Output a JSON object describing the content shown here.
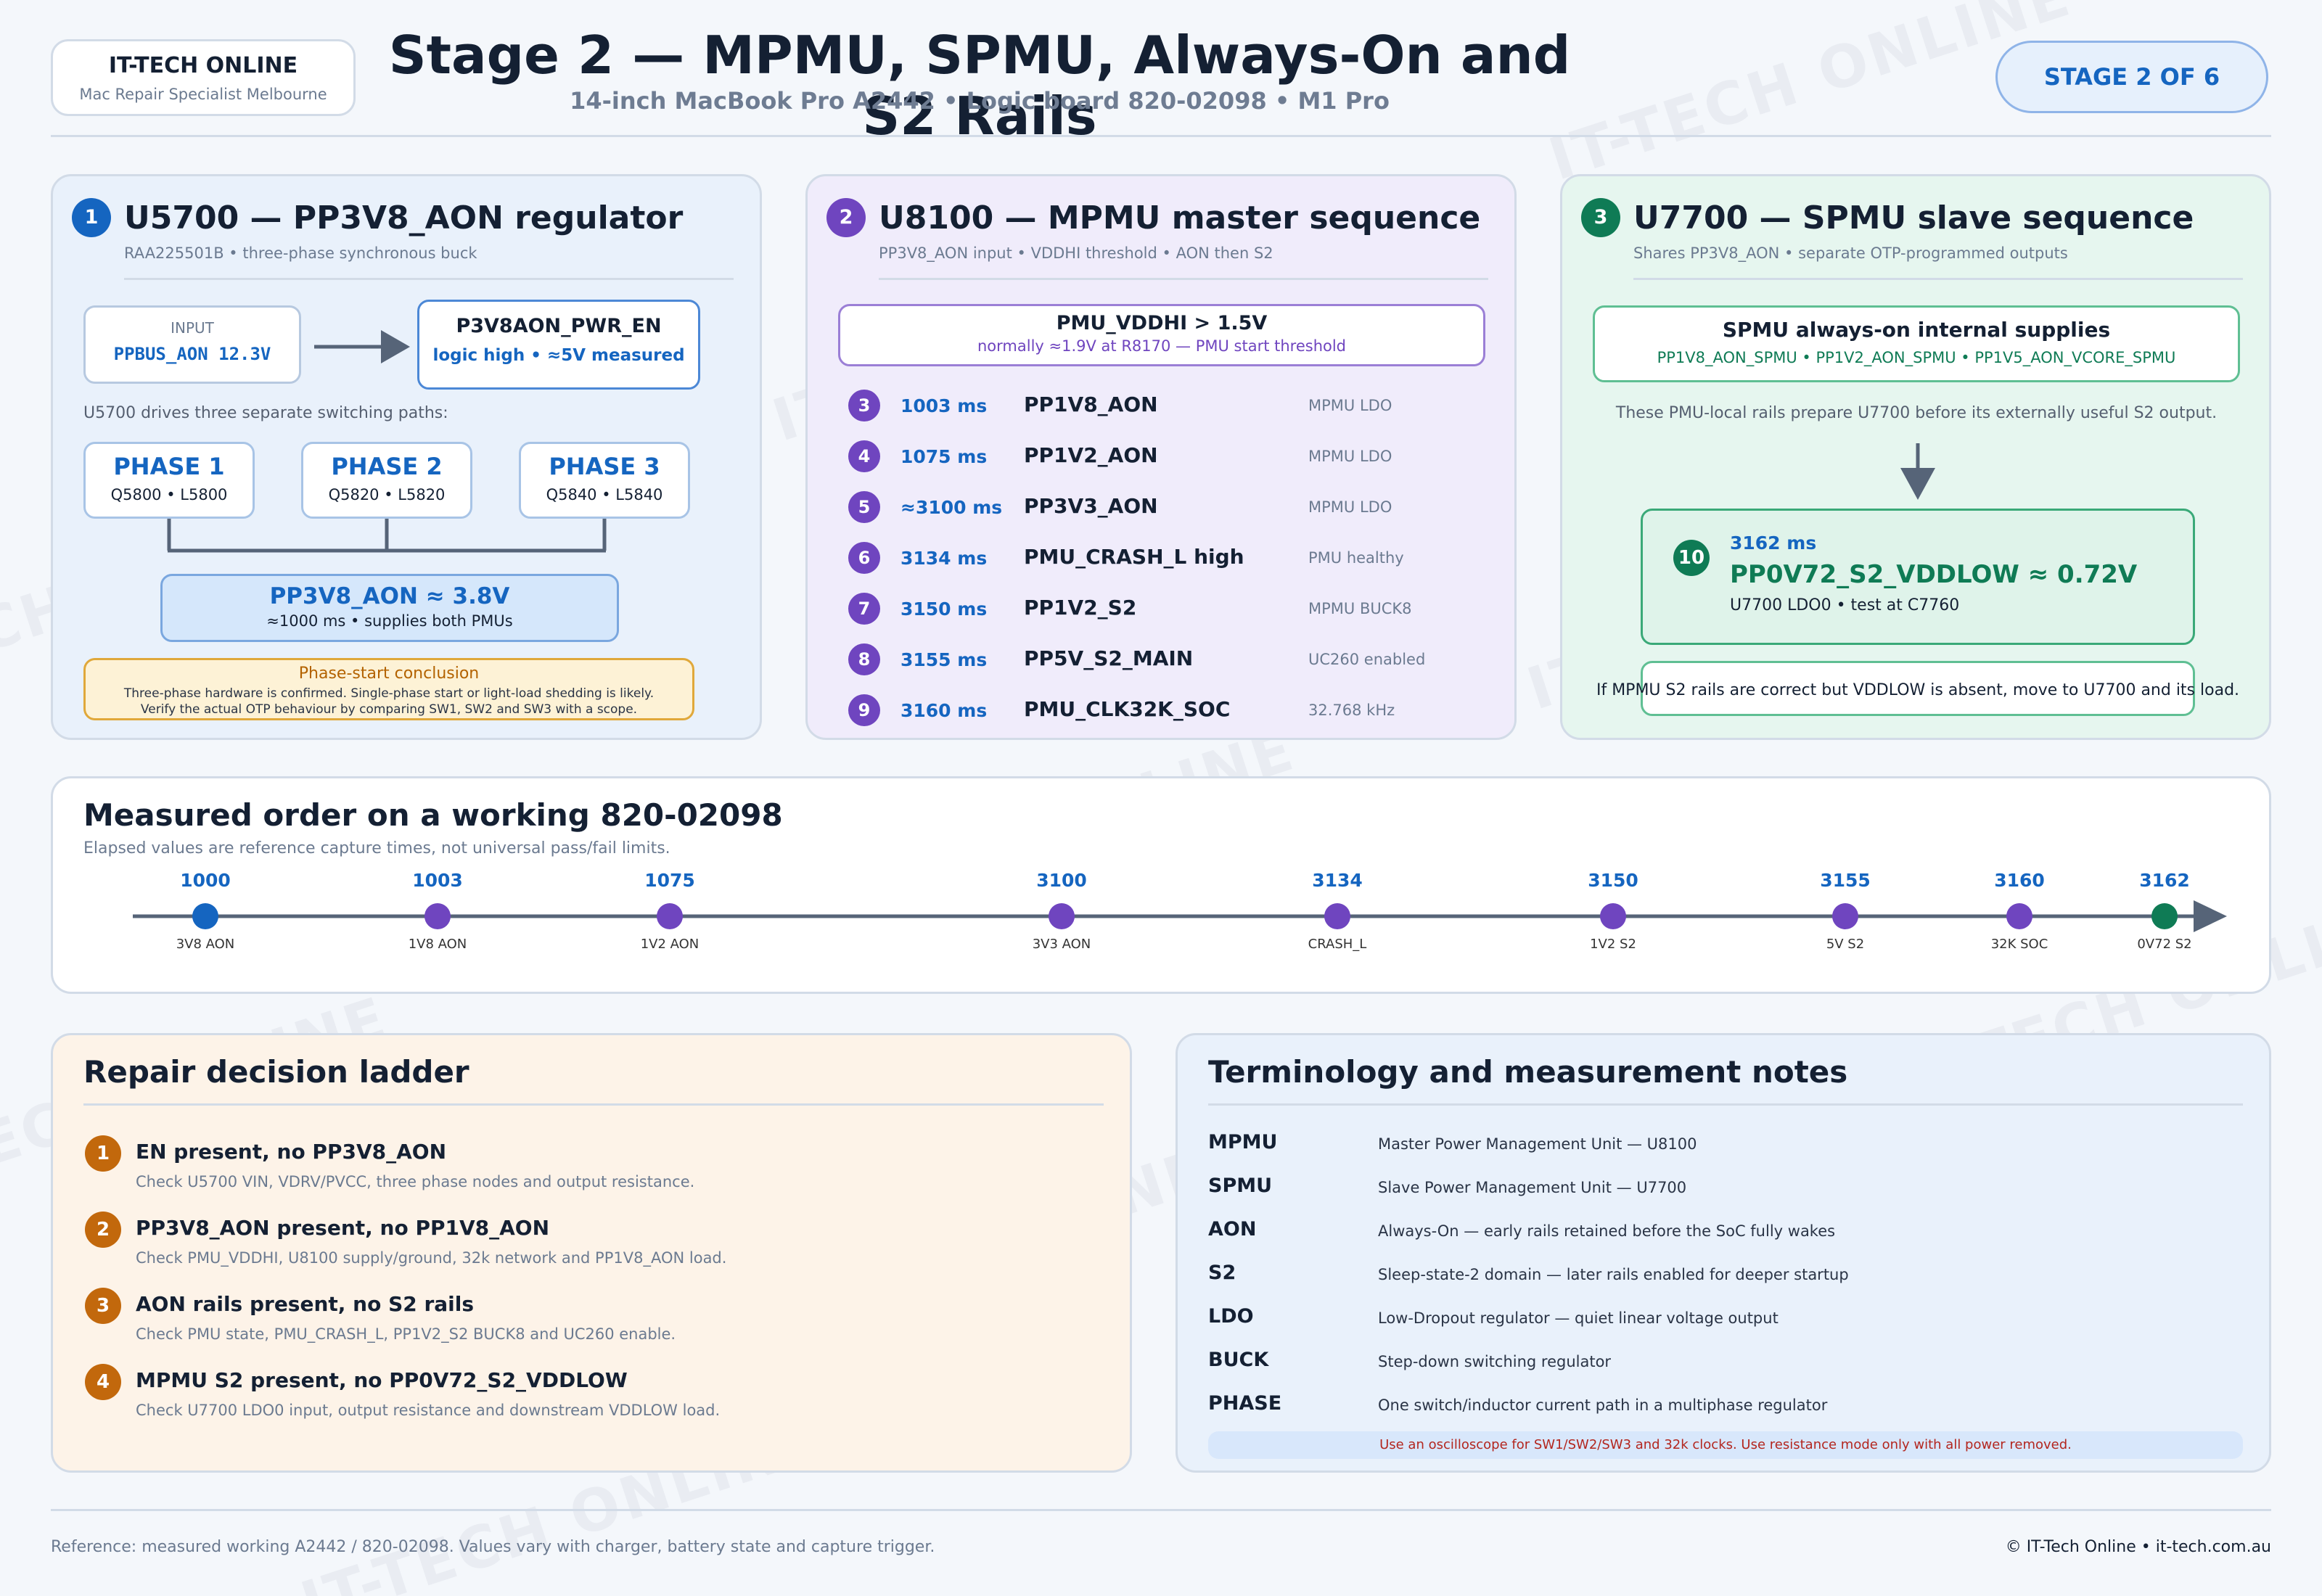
{
  "brand": {
    "name": "IT-TECH ONLINE",
    "tagline": "Mac Repair Specialist Melbourne"
  },
  "header": {
    "title": "Stage 2 — MPMU, SPMU, Always-On and S2 Rails",
    "subtitle": "14-inch MacBook Pro A2442 • Logic board 820-02098 • M1 Pro",
    "stage_badge": "STAGE 2 OF 6"
  },
  "watermark": "IT-TECH ONLINE",
  "panel1": {
    "num": "1",
    "title": "U5700 — PP3V8_AON regulator",
    "subtitle": "RAA225501B • three-phase synchronous buck",
    "input_label": "INPUT",
    "input_value": "PPBUS_AON 12.3V",
    "enable_name": "P3V8AON_PWR_EN",
    "enable_value": "logic high • ≈5V measured",
    "drives_text": "U5700 drives three separate switching paths:",
    "phases": [
      {
        "name": "PHASE 1",
        "parts": "Q5800 • L5800"
      },
      {
        "name": "PHASE 2",
        "parts": "Q5820 • L5820"
      },
      {
        "name": "PHASE 3",
        "parts": "Q5840 • L5840"
      }
    ],
    "output_name": "PP3V8_AON ≈ 3.8V",
    "output_note": "≈1000 ms • supplies both PMUs",
    "conclusion_title": "Phase-start conclusion",
    "conclusion_line1": "Three-phase hardware is confirmed. Single-phase start or light-load shedding is likely.",
    "conclusion_line2": "Verify the actual OTP behaviour by comparing SW1, SW2 and SW3 with a scope."
  },
  "panel2": {
    "num": "2",
    "title": "U8100 — MPMU master sequence",
    "subtitle": "PP3V8_AON input • VDDHI threshold • AON then S2",
    "threshold_title": "PMU_VDDHI > 1.5V",
    "threshold_note": "normally ≈1.9V at R8170 — PMU start threshold",
    "steps": [
      {
        "num": "3",
        "time": "1003 ms",
        "name": "PP1V8_AON",
        "desc": "MPMU LDO"
      },
      {
        "num": "4",
        "time": "1075 ms",
        "name": "PP1V2_AON",
        "desc": "MPMU LDO"
      },
      {
        "num": "5",
        "time": "≈3100 ms",
        "name": "PP3V3_AON",
        "desc": "MPMU LDO"
      },
      {
        "num": "6",
        "time": "3134 ms",
        "name": "PMU_CRASH_L high",
        "desc": "PMU healthy"
      },
      {
        "num": "7",
        "time": "3150 ms",
        "name": "PP1V2_S2",
        "desc": "MPMU BUCK8"
      },
      {
        "num": "8",
        "time": "3155 ms",
        "name": "PP5V_S2_MAIN",
        "desc": "UC260 enabled"
      },
      {
        "num": "9",
        "time": "3160 ms",
        "name": "PMU_CLK32K_SOC",
        "desc": "32.768 kHz"
      }
    ]
  },
  "panel3": {
    "num": "3",
    "title": "U7700 — SPMU slave sequence",
    "subtitle": "Shares PP3V8_AON • separate OTP-programmed outputs",
    "internal_title": "SPMU always-on internal supplies",
    "internal_rails": "PP1V8_AON_SPMU • PP1V2_AON_SPMU • PP1V5_AON_VCORE_SPMU",
    "internal_note": "These PMU-local rails prepare U7700 before its externally useful S2 output.",
    "out_num": "10",
    "out_time": "3162 ms",
    "out_name": "PP0V72_S2_VDDLOW ≈ 0.72V",
    "out_note": "U7700 LDO0 • test at C7760",
    "footer_note": "If MPMU S2 rails are correct but VDDLOW is absent, move to U7700 and its load."
  },
  "timeline": {
    "title": "Measured order on a working 820-02098",
    "subtitle": "Elapsed values are reference capture times, not universal pass/fail limits.",
    "points": [
      {
        "t": 1000,
        "label": "1000",
        "name": "3V8 AON",
        "color": "#1565c0"
      },
      {
        "t": 1003,
        "label": "1003",
        "name": "1V8 AON",
        "color": "#6f45bf"
      },
      {
        "t": 1075,
        "label": "1075",
        "name": "1V2 AON",
        "color": "#6f45bf"
      },
      {
        "t": 3100,
        "label": "3100",
        "name": "3V3 AON",
        "color": "#6f45bf"
      },
      {
        "t": 3134,
        "label": "3134",
        "name": "CRASH_L",
        "color": "#6f45bf"
      },
      {
        "t": 3150,
        "label": "3150",
        "name": "1V2 S2",
        "color": "#6f45bf"
      },
      {
        "t": 3155,
        "label": "3155",
        "name": "5V S2",
        "color": "#6f45bf"
      },
      {
        "t": 3160,
        "label": "3160",
        "name": "32K SOC",
        "color": "#6f45bf"
      },
      {
        "t": 3162,
        "label": "3162",
        "name": "0V72 S2",
        "color": "#0f7b55"
      }
    ]
  },
  "ladder": {
    "title": "Repair decision ladder",
    "items": [
      {
        "num": "1",
        "title": "EN present, no PP3V8_AON",
        "desc": "Check U5700 VIN, VDRV/PVCC, three phase nodes and output resistance."
      },
      {
        "num": "2",
        "title": "PP3V8_AON present, no PP1V8_AON",
        "desc": "Check PMU_VDDHI, U8100 supply/ground, 32k network and PP1V8_AON load."
      },
      {
        "num": "3",
        "title": "AON rails present, no S2 rails",
        "desc": "Check PMU state, PMU_CRASH_L, PP1V2_S2 BUCK8 and UC260 enable."
      },
      {
        "num": "4",
        "title": "MPMU S2 present, no PP0V72_S2_VDDLOW",
        "desc": "Check U7700 LDO0 input, output resistance and downstream VDDLOW load."
      }
    ]
  },
  "terms": {
    "title": "Terminology and measurement notes",
    "items": [
      {
        "term": "MPMU",
        "def": "Master Power Management Unit — U8100"
      },
      {
        "term": "SPMU",
        "def": "Slave Power Management Unit — U7700"
      },
      {
        "term": "AON",
        "def": "Always-On — early rails retained before the SoC fully wakes"
      },
      {
        "term": "S2",
        "def": "Sleep-state-2 domain — later rails enabled for deeper startup"
      },
      {
        "term": "LDO",
        "def": "Low-Dropout regulator — quiet linear voltage output"
      },
      {
        "term": "BUCK",
        "def": "Step-down switching regulator"
      },
      {
        "term": "PHASE",
        "def": "One switch/inductor current path in a multiphase regulator"
      }
    ],
    "warning": "Use an oscilloscope for SW1/SW2/SW3 and 32k clocks. Use resistance mode only with all power removed."
  },
  "footer": {
    "reference": "Reference: measured working A2442 / 820-02098. Values vary with charger, battery state and capture trigger.",
    "copyright": "© IT-Tech Online • it-tech.com.au"
  },
  "colors": {
    "accent_blue": "#1565c0",
    "accent_purple": "#6f45bf",
    "accent_green": "#0f7b55",
    "accent_orange": "#c2680c",
    "warning_red": "#b3261e"
  }
}
